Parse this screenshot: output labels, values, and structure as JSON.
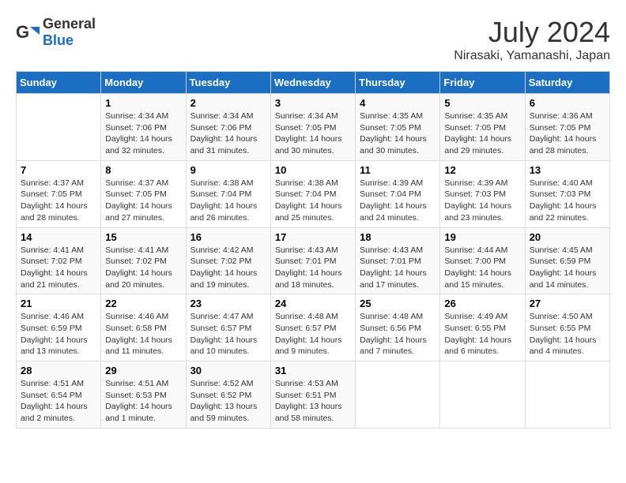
{
  "header": {
    "logo_general": "General",
    "logo_blue": "Blue",
    "title": "July 2024",
    "location": "Nirasaki, Yamanashi, Japan"
  },
  "calendar": {
    "days_of_week": [
      "Sunday",
      "Monday",
      "Tuesday",
      "Wednesday",
      "Thursday",
      "Friday",
      "Saturday"
    ],
    "weeks": [
      [
        {
          "day": "",
          "info": ""
        },
        {
          "day": "1",
          "info": "Sunrise: 4:34 AM\nSunset: 7:06 PM\nDaylight: 14 hours\nand 32 minutes."
        },
        {
          "day": "2",
          "info": "Sunrise: 4:34 AM\nSunset: 7:06 PM\nDaylight: 14 hours\nand 31 minutes."
        },
        {
          "day": "3",
          "info": "Sunrise: 4:34 AM\nSunset: 7:05 PM\nDaylight: 14 hours\nand 30 minutes."
        },
        {
          "day": "4",
          "info": "Sunrise: 4:35 AM\nSunset: 7:05 PM\nDaylight: 14 hours\nand 30 minutes."
        },
        {
          "day": "5",
          "info": "Sunrise: 4:35 AM\nSunset: 7:05 PM\nDaylight: 14 hours\nand 29 minutes."
        },
        {
          "day": "6",
          "info": "Sunrise: 4:36 AM\nSunset: 7:05 PM\nDaylight: 14 hours\nand 28 minutes."
        }
      ],
      [
        {
          "day": "7",
          "info": "Sunrise: 4:37 AM\nSunset: 7:05 PM\nDaylight: 14 hours\nand 28 minutes."
        },
        {
          "day": "8",
          "info": "Sunrise: 4:37 AM\nSunset: 7:05 PM\nDaylight: 14 hours\nand 27 minutes."
        },
        {
          "day": "9",
          "info": "Sunrise: 4:38 AM\nSunset: 7:04 PM\nDaylight: 14 hours\nand 26 minutes."
        },
        {
          "day": "10",
          "info": "Sunrise: 4:38 AM\nSunset: 7:04 PM\nDaylight: 14 hours\nand 25 minutes."
        },
        {
          "day": "11",
          "info": "Sunrise: 4:39 AM\nSunset: 7:04 PM\nDaylight: 14 hours\nand 24 minutes."
        },
        {
          "day": "12",
          "info": "Sunrise: 4:39 AM\nSunset: 7:03 PM\nDaylight: 14 hours\nand 23 minutes."
        },
        {
          "day": "13",
          "info": "Sunrise: 4:40 AM\nSunset: 7:03 PM\nDaylight: 14 hours\nand 22 minutes."
        }
      ],
      [
        {
          "day": "14",
          "info": "Sunrise: 4:41 AM\nSunset: 7:02 PM\nDaylight: 14 hours\nand 21 minutes."
        },
        {
          "day": "15",
          "info": "Sunrise: 4:41 AM\nSunset: 7:02 PM\nDaylight: 14 hours\nand 20 minutes."
        },
        {
          "day": "16",
          "info": "Sunrise: 4:42 AM\nSunset: 7:02 PM\nDaylight: 14 hours\nand 19 minutes."
        },
        {
          "day": "17",
          "info": "Sunrise: 4:43 AM\nSunset: 7:01 PM\nDaylight: 14 hours\nand 18 minutes."
        },
        {
          "day": "18",
          "info": "Sunrise: 4:43 AM\nSunset: 7:01 PM\nDaylight: 14 hours\nand 17 minutes."
        },
        {
          "day": "19",
          "info": "Sunrise: 4:44 AM\nSunset: 7:00 PM\nDaylight: 14 hours\nand 15 minutes."
        },
        {
          "day": "20",
          "info": "Sunrise: 4:45 AM\nSunset: 6:59 PM\nDaylight: 14 hours\nand 14 minutes."
        }
      ],
      [
        {
          "day": "21",
          "info": "Sunrise: 4:46 AM\nSunset: 6:59 PM\nDaylight: 14 hours\nand 13 minutes."
        },
        {
          "day": "22",
          "info": "Sunrise: 4:46 AM\nSunset: 6:58 PM\nDaylight: 14 hours\nand 11 minutes."
        },
        {
          "day": "23",
          "info": "Sunrise: 4:47 AM\nSunset: 6:57 PM\nDaylight: 14 hours\nand 10 minutes."
        },
        {
          "day": "24",
          "info": "Sunrise: 4:48 AM\nSunset: 6:57 PM\nDaylight: 14 hours\nand 9 minutes."
        },
        {
          "day": "25",
          "info": "Sunrise: 4:48 AM\nSunset: 6:56 PM\nDaylight: 14 hours\nand 7 minutes."
        },
        {
          "day": "26",
          "info": "Sunrise: 4:49 AM\nSunset: 6:55 PM\nDaylight: 14 hours\nand 6 minutes."
        },
        {
          "day": "27",
          "info": "Sunrise: 4:50 AM\nSunset: 6:55 PM\nDaylight: 14 hours\nand 4 minutes."
        }
      ],
      [
        {
          "day": "28",
          "info": "Sunrise: 4:51 AM\nSunset: 6:54 PM\nDaylight: 14 hours\nand 2 minutes."
        },
        {
          "day": "29",
          "info": "Sunrise: 4:51 AM\nSunset: 6:53 PM\nDaylight: 14 hours\nand 1 minute."
        },
        {
          "day": "30",
          "info": "Sunrise: 4:52 AM\nSunset: 6:52 PM\nDaylight: 13 hours\nand 59 minutes."
        },
        {
          "day": "31",
          "info": "Sunrise: 4:53 AM\nSunset: 6:51 PM\nDaylight: 13 hours\nand 58 minutes."
        },
        {
          "day": "",
          "info": ""
        },
        {
          "day": "",
          "info": ""
        },
        {
          "day": "",
          "info": ""
        }
      ]
    ]
  }
}
